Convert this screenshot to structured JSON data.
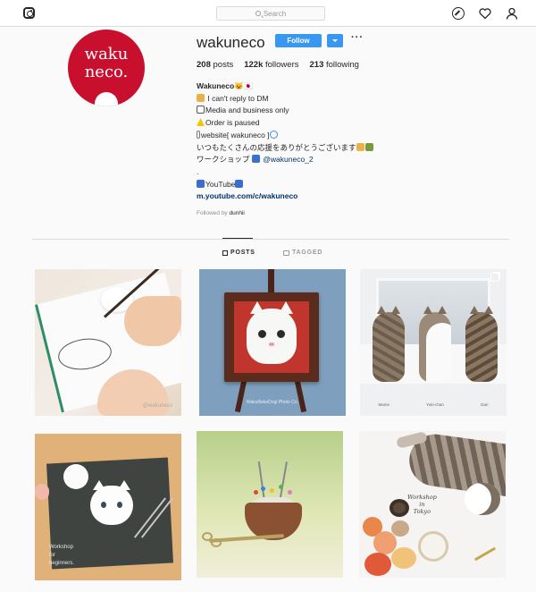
{
  "topbar": {
    "search_placeholder": "Search"
  },
  "profile": {
    "avatar_text_line1": "waku",
    "avatar_text_line2": "neco.",
    "username": "wakuneco",
    "follow_label": "Follow",
    "more_label": "···",
    "stats": {
      "posts_count": "208",
      "posts_label": "posts",
      "followers_count": "122k",
      "followers_label": "followers",
      "following_count": "213",
      "following_label": "following"
    },
    "bio": {
      "name": "Wakuneco",
      "name_suffix": "😺🇯🇵",
      "line1": "I can't reply to DM",
      "line2": "Media and business only",
      "line3": "Order is paused",
      "line4": "website[ wakuneco ]",
      "line5": "いつもたくさんの応援をありがとうございます",
      "line6_text": "ワークショップ",
      "line6_mention": "@wakuneco_2",
      "line7": ".",
      "line8": "YouTube",
      "link": "m.youtube.com/c/wakuneco"
    },
    "followed_by_label": "Followed by",
    "followed_by_user": "dunhii"
  },
  "tabs": {
    "posts": "POSTS",
    "tagged": "TAGGED"
  },
  "posts": {
    "p1_watermark": "@wakuneco",
    "p2_caption": "WakuNekoDogi Photo Co.",
    "p3_names": [
      "Mame",
      "Yuki-chan",
      "Gari"
    ],
    "p4_text_line1": "Workshop",
    "p4_text_line2": "for",
    "p4_text_line3": "beginners.",
    "p6_text_line1": "Workshop",
    "p6_text_line2": "in",
    "p6_text_line3": "Tokyo"
  },
  "colors": {
    "accent_blue": "#3897f0",
    "avatar_red": "#c8102e",
    "link_blue": "#003569"
  }
}
